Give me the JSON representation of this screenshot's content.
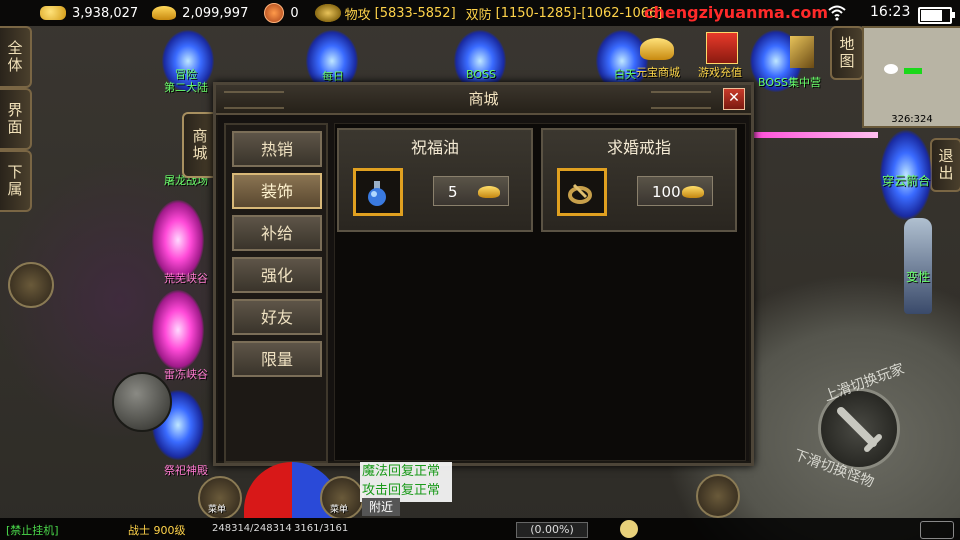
{
  "topbar": {
    "gold": "3,938,027",
    "ingot": "2,099,997",
    "badge": "0",
    "phys_attack_label": "物攻",
    "phys_attack": "[5833-5852]",
    "dual_def_label": "双防",
    "dual_def": "[1150-1285]-[1062-1066]",
    "watermark": "chengziyuanma.com",
    "time": "16:23",
    "battery_level": 0.8
  },
  "left_buttons": [
    "全体",
    "界面",
    "下属"
  ],
  "portals": [
    {
      "label": "冒险\n第二大陆",
      "color": "blue"
    },
    {
      "label": "每日",
      "color": "blue"
    },
    {
      "label": "BOSS",
      "color": "blue"
    },
    {
      "label": "白天",
      "color": "blue"
    },
    {
      "label": "屠龙战场",
      "color": "pink"
    },
    {
      "label": "荒芜峡谷",
      "color": "pink"
    },
    {
      "label": "雷冻峡谷",
      "color": "pink"
    },
    {
      "label": "祭祀神殿",
      "color": "blue"
    }
  ],
  "top_right": {
    "shop_label": "元宝商城",
    "recharge_label": "游戏充值",
    "boss_label": "BOSS集中营",
    "map_button": "地图",
    "coords": "326:324",
    "exit_button": "退出",
    "npc1": "穿云箭合",
    "npc2": "变性"
  },
  "side_tab": "商城",
  "dialog": {
    "title": "商城",
    "close": "✕",
    "categories": [
      {
        "label": "热销",
        "active": false
      },
      {
        "label": "装饰",
        "active": true
      },
      {
        "label": "补给",
        "active": false
      },
      {
        "label": "强化",
        "active": false
      },
      {
        "label": "好友",
        "active": false
      },
      {
        "label": "限量",
        "active": false
      }
    ],
    "items": [
      {
        "name": "祝福油",
        "price": "5",
        "icon": "potion-icon"
      },
      {
        "name": "求婚戒指",
        "price": "100",
        "icon": "ring-icon"
      }
    ]
  },
  "chat": {
    "line1": "魔法回复正常",
    "line2": "攻击回复正常",
    "nearby": "附近"
  },
  "bottom": {
    "no_afk": "[禁止挂机]",
    "class_level": "战士 900级",
    "hp_mp": "248314/248314",
    "exp": "3161/3161",
    "exp_pct": "(0.00%)",
    "menu1": "菜单",
    "menu2": "菜单",
    "swipe1": "上滑切换玩家",
    "swipe2": "下滑切换怪物"
  }
}
